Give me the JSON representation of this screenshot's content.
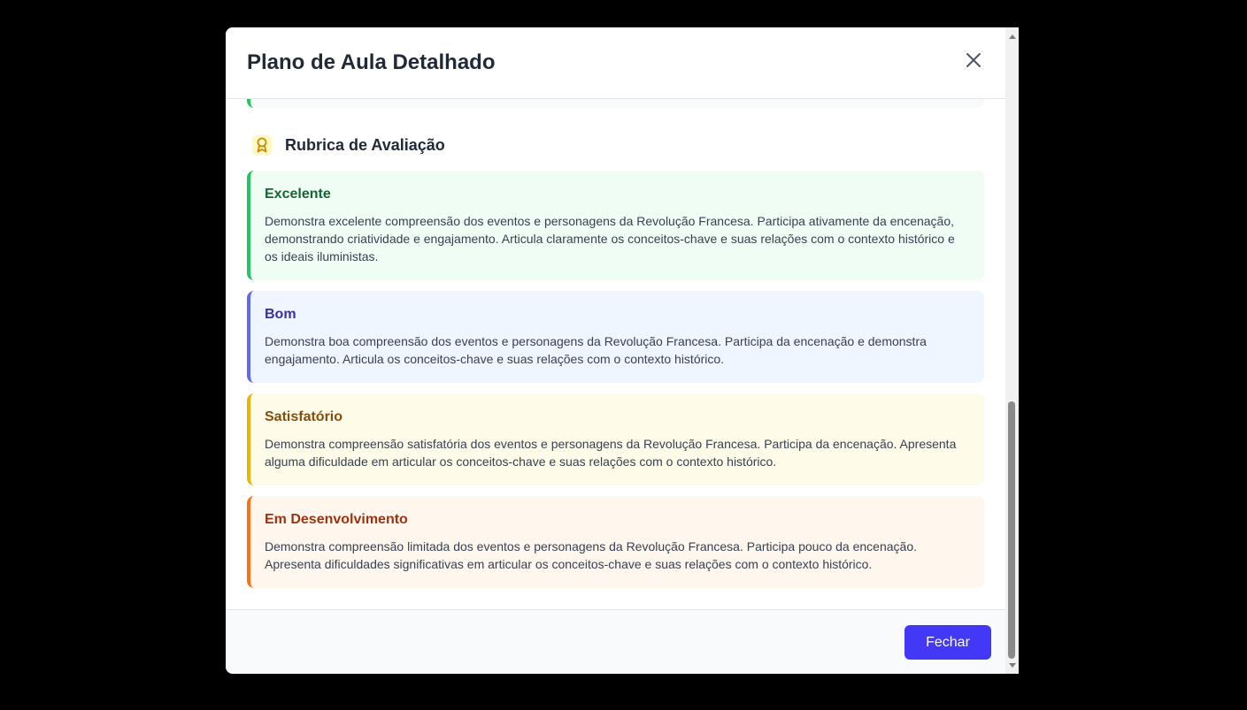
{
  "modal": {
    "title": "Plano de Aula Detalhado",
    "close_icon": "close-icon"
  },
  "section": {
    "icon": "award-ribbon-icon",
    "title": "Rubrica de Avaliação"
  },
  "rubric": [
    {
      "level": "Excelente",
      "description": "Demonstra excelente compreensão dos eventos e personagens da Revolução Francesa. Participa ativamente da encenação, demonstrando criatividade e engajamento. Articula claramente os conceitos-chave e suas relações com o contexto histórico e os ideais iluministas.",
      "accent": "#22c55e",
      "title_color": "#166534",
      "background": "#f0fdf4"
    },
    {
      "level": "Bom",
      "description": "Demonstra boa compreensão dos eventos e personagens da Revolução Francesa. Participa da encenação e demonstra engajamento. Articula os conceitos-chave e suas relações com o contexto histórico.",
      "accent": "#6366f1",
      "title_color": "#3730a3",
      "background": "#eff6ff"
    },
    {
      "level": "Satisfatório",
      "description": "Demonstra compreensão satisfatória dos eventos e personagens da Revolução Francesa. Participa da encenação. Apresenta alguma dificuldade em articular os conceitos-chave e suas relações com o contexto histórico.",
      "accent": "#eab308",
      "title_color": "#854d0e",
      "background": "#fefce8"
    },
    {
      "level": "Em Desenvolvimento",
      "description": "Demonstra compreensão limitada dos eventos e personagens da Revolução Francesa. Participa pouco da encenação. Apresenta dificuldades significativas em articular os conceitos-chave e suas relações com o contexto histórico.",
      "accent": "#f97316",
      "title_color": "#9a3412",
      "background": "#fff7ed"
    }
  ],
  "footer": {
    "close_label": "Fechar",
    "button_color": "#4338f5"
  },
  "scroll": {
    "position_fraction": 0.72
  }
}
